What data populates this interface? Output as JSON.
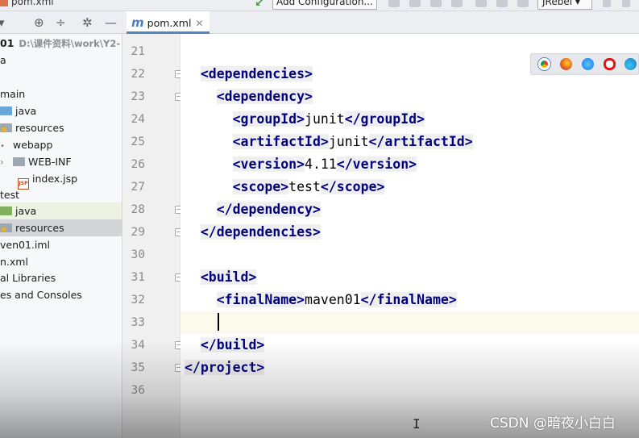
{
  "window": {
    "title": "pom.xml",
    "run_config_label": "Add Configuration...",
    "jrebel_label": "JRebel ▾"
  },
  "project_panel": {
    "items": [
      {
        "label": "01",
        "path": "D:\\课件资料\\work\\Y2-",
        "indent": 0,
        "icon": "none"
      },
      {
        "label": "a",
        "indent": 0,
        "icon": "none"
      },
      {
        "label": "",
        "indent": 0,
        "icon": "none"
      },
      {
        "label": "main",
        "indent": 0,
        "icon": "none"
      },
      {
        "label": "java",
        "indent": 1,
        "icon": "folder-blue"
      },
      {
        "label": "resources",
        "indent": 1,
        "icon": "folder-resources"
      },
      {
        "label": "webapp",
        "indent": 1,
        "icon": "dot"
      },
      {
        "label": "WEB-INF",
        "indent": 2,
        "icon": "folder-grey"
      },
      {
        "label": "index.jsp",
        "indent": 3,
        "icon": "jsp"
      },
      {
        "label": "test",
        "indent": 0,
        "icon": "none"
      },
      {
        "label": "java",
        "indent": 1,
        "icon": "folder-green"
      },
      {
        "label": "resources",
        "indent": 1,
        "icon": "folder-resources"
      },
      {
        "label": "ven01.iml",
        "indent": 0,
        "icon": "none"
      },
      {
        "label": "n.xml",
        "indent": 0,
        "icon": "none"
      },
      {
        "label": "al Libraries",
        "indent": 0,
        "icon": "none"
      },
      {
        "label": "es and Consoles",
        "indent": 0,
        "icon": "none"
      }
    ]
  },
  "editor": {
    "tab_label": "pom.xml",
    "current_line": 33,
    "lines": [
      {
        "n": "21",
        "parts": []
      },
      {
        "n": "22",
        "parts": [
          {
            "t": "  ",
            "k": "txt"
          },
          {
            "t": "<dependencies>",
            "k": "tag"
          }
        ]
      },
      {
        "n": "23",
        "parts": [
          {
            "t": "    ",
            "k": "txt"
          },
          {
            "t": "<dependency>",
            "k": "tag"
          }
        ]
      },
      {
        "n": "24",
        "parts": [
          {
            "t": "      ",
            "k": "txt"
          },
          {
            "t": "<groupId>",
            "k": "tag"
          },
          {
            "t": "junit",
            "k": "txt"
          },
          {
            "t": "</groupId>",
            "k": "tag"
          }
        ]
      },
      {
        "n": "25",
        "parts": [
          {
            "t": "      ",
            "k": "txt"
          },
          {
            "t": "<artifactId>",
            "k": "tag"
          },
          {
            "t": "junit",
            "k": "txt"
          },
          {
            "t": "</artifactId>",
            "k": "tag"
          }
        ]
      },
      {
        "n": "26",
        "parts": [
          {
            "t": "      ",
            "k": "txt"
          },
          {
            "t": "<version>",
            "k": "tag"
          },
          {
            "t": "4.11",
            "k": "txt"
          },
          {
            "t": "</version>",
            "k": "tag"
          }
        ]
      },
      {
        "n": "27",
        "parts": [
          {
            "t": "      ",
            "k": "txt"
          },
          {
            "t": "<scope>",
            "k": "tag"
          },
          {
            "t": "test",
            "k": "txt"
          },
          {
            "t": "</scope>",
            "k": "tag"
          }
        ]
      },
      {
        "n": "28",
        "parts": [
          {
            "t": "    ",
            "k": "txt"
          },
          {
            "t": "</dependency>",
            "k": "tag"
          }
        ]
      },
      {
        "n": "29",
        "parts": [
          {
            "t": "  ",
            "k": "txt"
          },
          {
            "t": "</dependencies>",
            "k": "tag"
          }
        ]
      },
      {
        "n": "30",
        "parts": []
      },
      {
        "n": "31",
        "parts": [
          {
            "t": "  ",
            "k": "txt"
          },
          {
            "t": "<build>",
            "k": "tag"
          }
        ]
      },
      {
        "n": "32",
        "parts": [
          {
            "t": "    ",
            "k": "txt"
          },
          {
            "t": "<finalName>",
            "k": "tag"
          },
          {
            "t": "maven01",
            "k": "txt"
          },
          {
            "t": "</finalName>",
            "k": "tag"
          }
        ]
      },
      {
        "n": "33",
        "parts": []
      },
      {
        "n": "34",
        "parts": [
          {
            "t": "  ",
            "k": "txt"
          },
          {
            "t": "</build>",
            "k": "tag"
          }
        ]
      },
      {
        "n": "35",
        "parts": [
          {
            "t": "</project>",
            "k": "tag"
          }
        ]
      },
      {
        "n": "36",
        "parts": []
      }
    ]
  },
  "browser_icons": [
    "chrome-icon",
    "firefox-icon",
    "safari-icon",
    "opera-icon",
    "edge-icon"
  ],
  "watermark": "CSDN @暗夜小白白",
  "colors": {
    "tag": "#000080",
    "tag_bg": "#efefef",
    "current_line_bg": "#fcfaed",
    "tab_underline": "#4a88c7"
  }
}
